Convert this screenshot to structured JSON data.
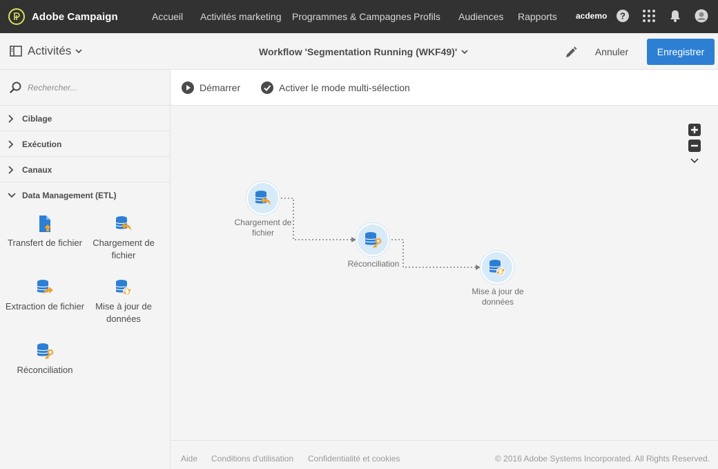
{
  "topnav": {
    "brand": "Adobe Campaign",
    "items": [
      "Accueil",
      "Activités marketing",
      "Programmes & Campagnes",
      "Profils",
      "Audiences",
      "Rapports"
    ],
    "user": "acdemo",
    "icons": [
      "help-icon",
      "apps-grid-icon",
      "bell-icon",
      "user-avatar-icon"
    ]
  },
  "actionbar": {
    "section_label": "Activités",
    "workflow_title": "Workflow 'Segmentation Running (WKF49)'",
    "cancel_label": "Annuler",
    "save_label": "Enregistrer"
  },
  "sidebar": {
    "search_placeholder": "Rechercher...",
    "sections": [
      "Ciblage",
      "Exécution",
      "Canaux",
      "Data Management (ETL)"
    ],
    "tools": [
      "Transfert de fichier",
      "Chargement de fichier",
      "Extraction de fichier",
      "Mise à jour de données",
      "Réconciliation"
    ]
  },
  "toolbar": {
    "start_label": "Démarrer",
    "multiselect_label": "Activer le mode multi-sélection"
  },
  "workflow": {
    "nodes": [
      "Chargement de fichier",
      "Réconciliation",
      "Mise à jour de données"
    ]
  },
  "footer": {
    "links": [
      "Aide",
      "Conditions d'utilisation",
      "Confidentialité et cookies"
    ],
    "copyright": "© 2016 Adobe Systems Incorporated. All Rights Reserved."
  },
  "colors": {
    "topbar": "#323232",
    "primary_button": "#2d7fd4",
    "icon_blue": "#2d7fd4",
    "icon_orange": "#f0a32c",
    "node_fill": "#d7eaf8"
  }
}
